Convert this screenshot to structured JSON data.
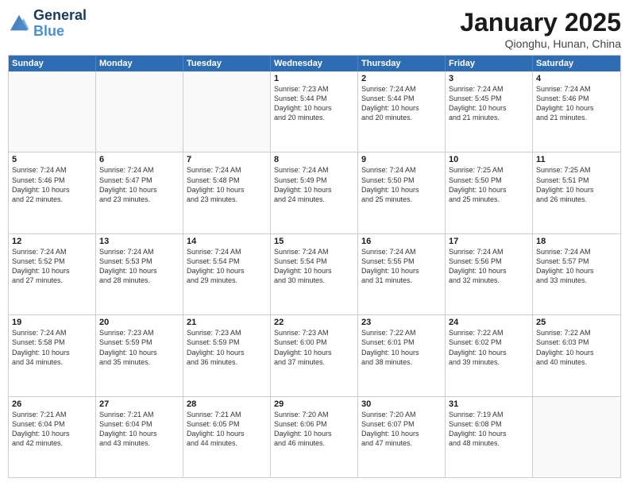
{
  "logo": {
    "line1": "General",
    "line2": "Blue"
  },
  "title": "January 2025",
  "subtitle": "Qionghu, Hunan, China",
  "columns": [
    "Sunday",
    "Monday",
    "Tuesday",
    "Wednesday",
    "Thursday",
    "Friday",
    "Saturday"
  ],
  "weeks": [
    [
      {
        "num": "",
        "detail": "",
        "empty": true
      },
      {
        "num": "",
        "detail": "",
        "empty": true
      },
      {
        "num": "",
        "detail": "",
        "empty": true
      },
      {
        "num": "1",
        "detail": "Sunrise: 7:23 AM\nSunset: 5:44 PM\nDaylight: 10 hours\nand 20 minutes."
      },
      {
        "num": "2",
        "detail": "Sunrise: 7:24 AM\nSunset: 5:44 PM\nDaylight: 10 hours\nand 20 minutes."
      },
      {
        "num": "3",
        "detail": "Sunrise: 7:24 AM\nSunset: 5:45 PM\nDaylight: 10 hours\nand 21 minutes."
      },
      {
        "num": "4",
        "detail": "Sunrise: 7:24 AM\nSunset: 5:46 PM\nDaylight: 10 hours\nand 21 minutes."
      }
    ],
    [
      {
        "num": "5",
        "detail": "Sunrise: 7:24 AM\nSunset: 5:46 PM\nDaylight: 10 hours\nand 22 minutes."
      },
      {
        "num": "6",
        "detail": "Sunrise: 7:24 AM\nSunset: 5:47 PM\nDaylight: 10 hours\nand 23 minutes."
      },
      {
        "num": "7",
        "detail": "Sunrise: 7:24 AM\nSunset: 5:48 PM\nDaylight: 10 hours\nand 23 minutes."
      },
      {
        "num": "8",
        "detail": "Sunrise: 7:24 AM\nSunset: 5:49 PM\nDaylight: 10 hours\nand 24 minutes."
      },
      {
        "num": "9",
        "detail": "Sunrise: 7:24 AM\nSunset: 5:50 PM\nDaylight: 10 hours\nand 25 minutes."
      },
      {
        "num": "10",
        "detail": "Sunrise: 7:25 AM\nSunset: 5:50 PM\nDaylight: 10 hours\nand 25 minutes."
      },
      {
        "num": "11",
        "detail": "Sunrise: 7:25 AM\nSunset: 5:51 PM\nDaylight: 10 hours\nand 26 minutes."
      }
    ],
    [
      {
        "num": "12",
        "detail": "Sunrise: 7:24 AM\nSunset: 5:52 PM\nDaylight: 10 hours\nand 27 minutes."
      },
      {
        "num": "13",
        "detail": "Sunrise: 7:24 AM\nSunset: 5:53 PM\nDaylight: 10 hours\nand 28 minutes."
      },
      {
        "num": "14",
        "detail": "Sunrise: 7:24 AM\nSunset: 5:54 PM\nDaylight: 10 hours\nand 29 minutes."
      },
      {
        "num": "15",
        "detail": "Sunrise: 7:24 AM\nSunset: 5:54 PM\nDaylight: 10 hours\nand 30 minutes."
      },
      {
        "num": "16",
        "detail": "Sunrise: 7:24 AM\nSunset: 5:55 PM\nDaylight: 10 hours\nand 31 minutes."
      },
      {
        "num": "17",
        "detail": "Sunrise: 7:24 AM\nSunset: 5:56 PM\nDaylight: 10 hours\nand 32 minutes."
      },
      {
        "num": "18",
        "detail": "Sunrise: 7:24 AM\nSunset: 5:57 PM\nDaylight: 10 hours\nand 33 minutes."
      }
    ],
    [
      {
        "num": "19",
        "detail": "Sunrise: 7:24 AM\nSunset: 5:58 PM\nDaylight: 10 hours\nand 34 minutes."
      },
      {
        "num": "20",
        "detail": "Sunrise: 7:23 AM\nSunset: 5:59 PM\nDaylight: 10 hours\nand 35 minutes."
      },
      {
        "num": "21",
        "detail": "Sunrise: 7:23 AM\nSunset: 5:59 PM\nDaylight: 10 hours\nand 36 minutes."
      },
      {
        "num": "22",
        "detail": "Sunrise: 7:23 AM\nSunset: 6:00 PM\nDaylight: 10 hours\nand 37 minutes."
      },
      {
        "num": "23",
        "detail": "Sunrise: 7:22 AM\nSunset: 6:01 PM\nDaylight: 10 hours\nand 38 minutes."
      },
      {
        "num": "24",
        "detail": "Sunrise: 7:22 AM\nSunset: 6:02 PM\nDaylight: 10 hours\nand 39 minutes."
      },
      {
        "num": "25",
        "detail": "Sunrise: 7:22 AM\nSunset: 6:03 PM\nDaylight: 10 hours\nand 40 minutes."
      }
    ],
    [
      {
        "num": "26",
        "detail": "Sunrise: 7:21 AM\nSunset: 6:04 PM\nDaylight: 10 hours\nand 42 minutes."
      },
      {
        "num": "27",
        "detail": "Sunrise: 7:21 AM\nSunset: 6:04 PM\nDaylight: 10 hours\nand 43 minutes."
      },
      {
        "num": "28",
        "detail": "Sunrise: 7:21 AM\nSunset: 6:05 PM\nDaylight: 10 hours\nand 44 minutes."
      },
      {
        "num": "29",
        "detail": "Sunrise: 7:20 AM\nSunset: 6:06 PM\nDaylight: 10 hours\nand 46 minutes."
      },
      {
        "num": "30",
        "detail": "Sunrise: 7:20 AM\nSunset: 6:07 PM\nDaylight: 10 hours\nand 47 minutes."
      },
      {
        "num": "31",
        "detail": "Sunrise: 7:19 AM\nSunset: 6:08 PM\nDaylight: 10 hours\nand 48 minutes."
      },
      {
        "num": "",
        "detail": "",
        "empty": true
      }
    ]
  ]
}
